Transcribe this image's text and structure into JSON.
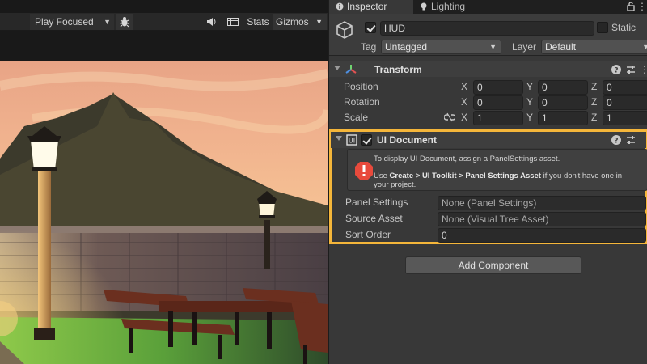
{
  "game_toolbar": {
    "play_mode": "Play Focused",
    "stats": "Stats",
    "gizmos": "Gizmos"
  },
  "inspector": {
    "tabs": [
      {
        "label": "Inspector",
        "active": true,
        "icon": "info-icon"
      },
      {
        "label": "Lighting",
        "active": false,
        "icon": "bulb-icon"
      }
    ],
    "object": {
      "name": "HUD",
      "active": true,
      "static_label": "Static",
      "tag_label": "Tag",
      "tag_value": "Untagged",
      "layer_label": "Layer",
      "layer_value": "Default"
    },
    "transform": {
      "title": "Transform",
      "position": {
        "label": "Position",
        "x": "0",
        "y": "0",
        "z": "0"
      },
      "rotation": {
        "label": "Rotation",
        "x": "0",
        "y": "0",
        "z": "0"
      },
      "scale": {
        "label": "Scale",
        "x": "1",
        "y": "1",
        "z": "1"
      },
      "axis_x": "X",
      "axis_y": "Y",
      "axis_z": "Z"
    },
    "ui_document": {
      "title": "UI Document",
      "enabled": true,
      "help_line1": "To display UI Document, assign a PanelSettings asset.",
      "help_line2_pre": "Use ",
      "help_line2_bold": "Create > UI Toolkit > Panel Settings Asset",
      "help_line2_post": " if you don't have one in",
      "help_line3": "your project.",
      "panel_settings_label": "Panel Settings",
      "panel_settings_value": "None (Panel Settings)",
      "source_asset_label": "Source Asset",
      "source_asset_value": "None (Visual Tree Asset)",
      "sort_order_label": "Sort Order",
      "sort_order_value": "0"
    },
    "add_component": "Add Component"
  },
  "colors": {
    "highlight": "#f5b63a",
    "error_red": "#e84a3c",
    "panel_bg": "#383838"
  }
}
